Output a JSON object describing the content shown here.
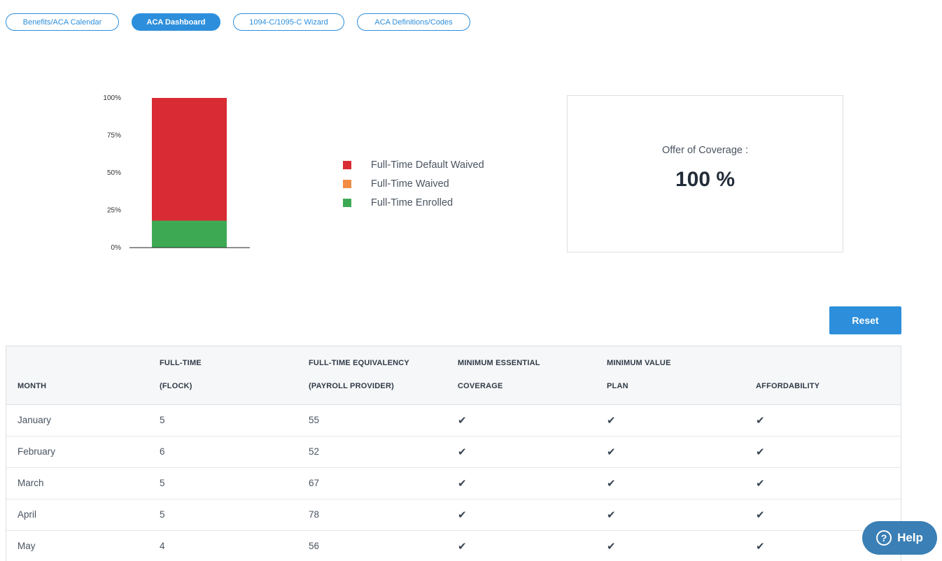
{
  "tabs": [
    {
      "label": "Benefits/ACA Calendar",
      "active": false
    },
    {
      "label": "ACA Dashboard",
      "active": true
    },
    {
      "label": "1094-C/1095-C Wizard",
      "active": false
    },
    {
      "label": "ACA Definitions/Codes",
      "active": false
    }
  ],
  "chart_data": {
    "type": "bar",
    "stacked": true,
    "categories": [
      ""
    ],
    "series": [
      {
        "name": "Full-Time Enrolled",
        "values": [
          18
        ],
        "color": "#3daa53"
      },
      {
        "name": "Full-Time Waived",
        "values": [
          0
        ],
        "color": "#f28c43"
      },
      {
        "name": "Full-Time Default Waived",
        "values": [
          82
        ],
        "color": "#d92b33"
      }
    ],
    "yticks": [
      "0%",
      "25%",
      "50%",
      "75%",
      "100%"
    ],
    "ylim": [
      0,
      100
    ],
    "title": "",
    "xlabel": "",
    "ylabel": ""
  },
  "legend": [
    {
      "label": "Full-Time Default Waived",
      "color": "#d92b33"
    },
    {
      "label": "Full-Time Waived",
      "color": "#f28c43"
    },
    {
      "label": "Full-Time Enrolled",
      "color": "#3daa53"
    }
  ],
  "coverage": {
    "label": "Offer of Coverage :",
    "value": "100 %"
  },
  "reset_label": "Reset",
  "table": {
    "headers": [
      {
        "line1": "",
        "line2": "MONTH"
      },
      {
        "line1": "FULL-TIME",
        "line2": "(FLOCK)"
      },
      {
        "line1": "FULL-TIME EQUIVALENCY",
        "line2": "(PAYROLL PROVIDER)"
      },
      {
        "line1": "MINIMUM ESSENTIAL",
        "line2": "COVERAGE"
      },
      {
        "line1": "MINIMUM VALUE",
        "line2": "PLAN"
      },
      {
        "line1": "",
        "line2": "AFFORDABILITY"
      }
    ],
    "rows": [
      {
        "month": "January",
        "full_time": "5",
        "fte": "55",
        "mec": "✔",
        "mvp": "✔",
        "aff": "✔"
      },
      {
        "month": "February",
        "full_time": "6",
        "fte": "52",
        "mec": "✔",
        "mvp": "✔",
        "aff": "✔"
      },
      {
        "month": "March",
        "full_time": "5",
        "fte": "67",
        "mec": "✔",
        "mvp": "✔",
        "aff": "✔"
      },
      {
        "month": "April",
        "full_time": "5",
        "fte": "78",
        "mec": "✔",
        "mvp": "✔",
        "aff": "✔"
      },
      {
        "month": "May",
        "full_time": "4",
        "fte": "56",
        "mec": "✔",
        "mvp": "✔",
        "aff": "✔"
      }
    ]
  },
  "help": {
    "label": "Help",
    "icon": "question-circle-icon"
  }
}
